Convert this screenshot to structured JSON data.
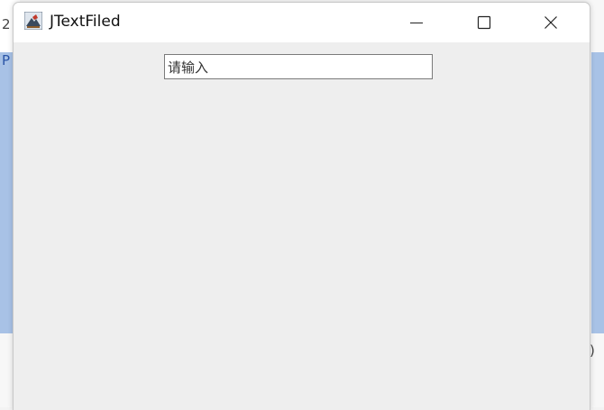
{
  "window": {
    "title": "JTextFiled",
    "controls": {
      "minimize_icon": "minimize-icon",
      "maximize_icon": "maximize-icon",
      "close_icon": "close-icon"
    }
  },
  "content": {
    "text_field": {
      "value": "请输入"
    }
  },
  "background": {
    "fragments": [
      "2",
      "P",
      ")"
    ]
  },
  "colors": {
    "window_bg": "#eeeeee",
    "titlebar_bg": "#ffffff",
    "desktop_blue": "#a8c2e6"
  }
}
